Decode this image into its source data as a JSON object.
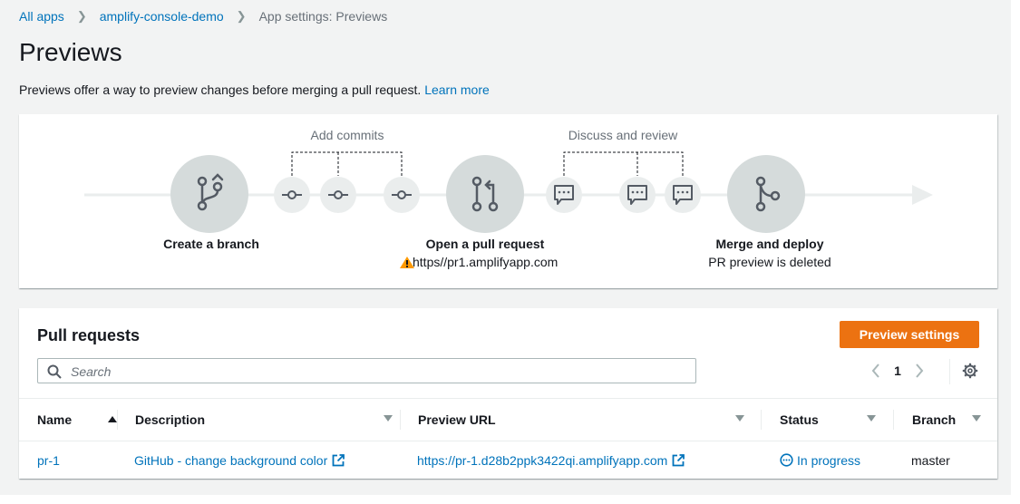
{
  "breadcrumb": {
    "items": [
      "All apps",
      "amplify-console-demo"
    ],
    "current": "App settings: Previews"
  },
  "page": {
    "title": "Previews",
    "description": "Previews offer a way to preview changes before merging a pull request.",
    "learn_more": "Learn more"
  },
  "flow": {
    "add_commits_label": "Add commits",
    "discuss_label": "Discuss and review",
    "steps": [
      {
        "title": "Create a branch",
        "subtitle": ""
      },
      {
        "title": "Open a pull request",
        "subtitle": "https//pr1.amplifyapp.com"
      },
      {
        "title": "Merge and deploy",
        "subtitle": "PR preview is deleted"
      }
    ]
  },
  "pull_requests": {
    "title": "Pull requests",
    "preview_settings_button": "Preview settings",
    "search_placeholder": "Search",
    "page_number": "1",
    "columns": [
      "Name",
      "Description",
      "Preview URL",
      "Status",
      "Branch"
    ],
    "rows": [
      {
        "name": "pr-1",
        "description": "GitHub - change background color",
        "preview_url": "https://pr-1.d28b2ppk3422qi.amplifyapp.com",
        "status": "In progress",
        "branch": "master"
      }
    ]
  },
  "colors": {
    "link": "#0073bb",
    "primary_button": "#ec7211",
    "warning": "#ff9900",
    "circle_fill": "#d5dbdb",
    "icon_stroke": "#545b64"
  }
}
